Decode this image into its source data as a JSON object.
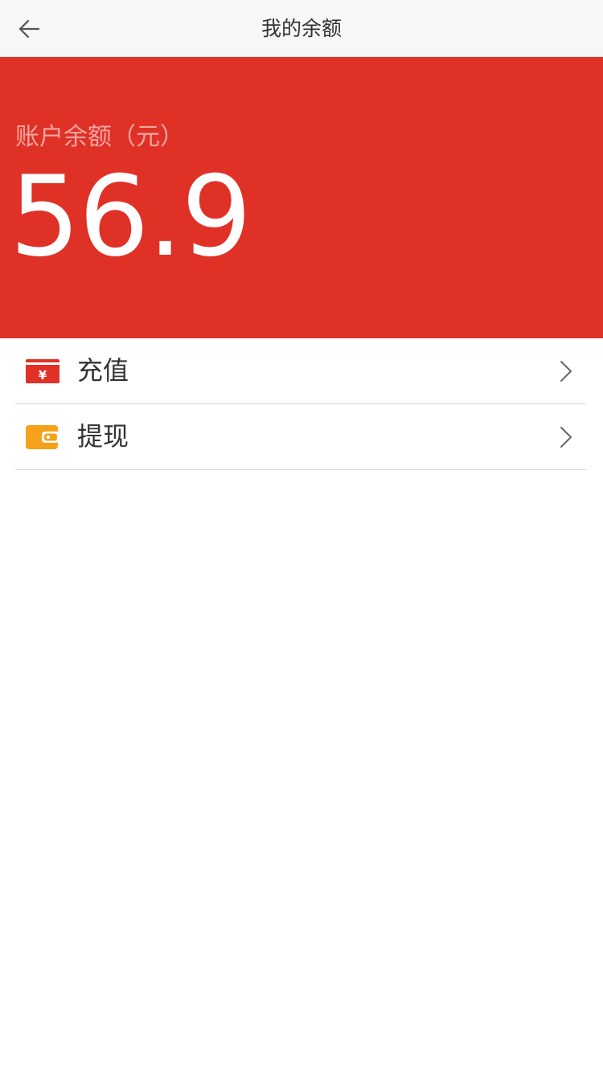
{
  "header": {
    "title": "我的余额",
    "back_icon": "back-arrow-icon"
  },
  "balance": {
    "label": "账户余额（元）",
    "value": "56.9"
  },
  "menu": {
    "items": [
      {
        "label": "充值",
        "icon": "recharge-yuan-card-icon",
        "icon_color": "#e03127"
      },
      {
        "label": "提现",
        "icon": "wallet-icon",
        "icon_color": "#f5a11a"
      }
    ]
  },
  "colors": {
    "accent": "#e03127",
    "header_bg": "#f7f7f7",
    "label_pink": "#f5a6a0",
    "wallet_orange": "#f5a11a"
  }
}
